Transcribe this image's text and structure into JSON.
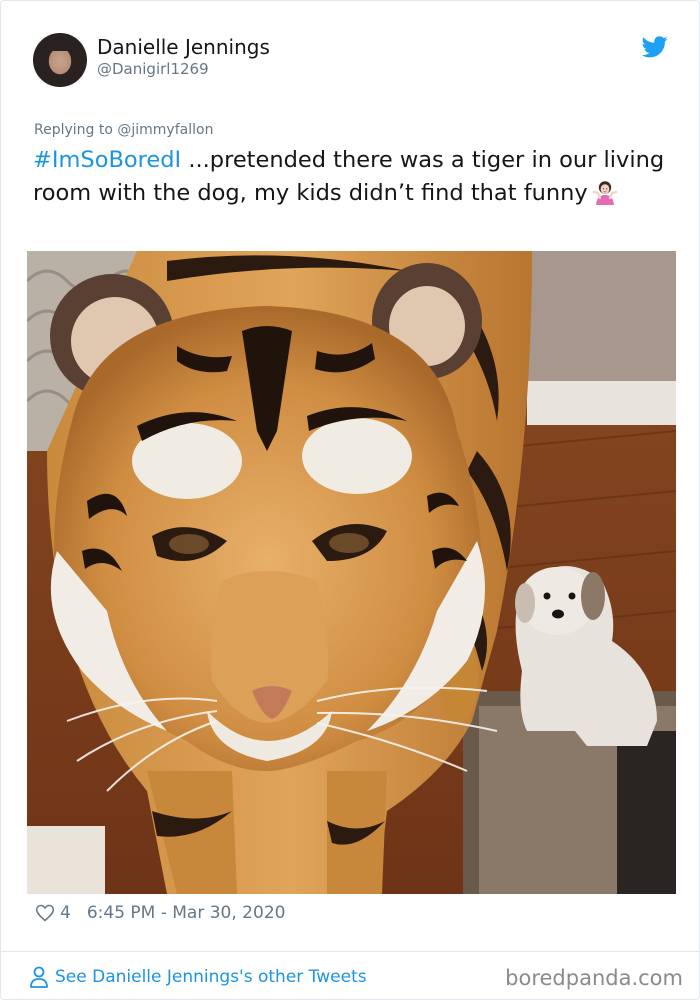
{
  "tweet": {
    "author_name": "Danielle Jennings",
    "author_handle": "@Danigirl1269",
    "replying_to": "Replying to @jimmyfallon",
    "hashtag": "#ImSoBoredI",
    "body": " ...pretended there was a tiger in our living room with the dog, my kids didn’t find that funny",
    "emoji": "woman-shrugging-emoji",
    "photo": "tiger-and-dog-photo",
    "likes": "4",
    "timestamp": "6:45 PM - Mar 30, 2020"
  },
  "footer": {
    "other_tweets_link": "See Danielle Jennings's other Tweets",
    "brand": "boredpanda.com"
  },
  "colors": {
    "link": "#1b95e0",
    "muted": "#657786",
    "border": "#e1e8ed"
  },
  "icons": [
    "avatar",
    "twitter-bird-icon",
    "heart-icon",
    "person-icon"
  ]
}
